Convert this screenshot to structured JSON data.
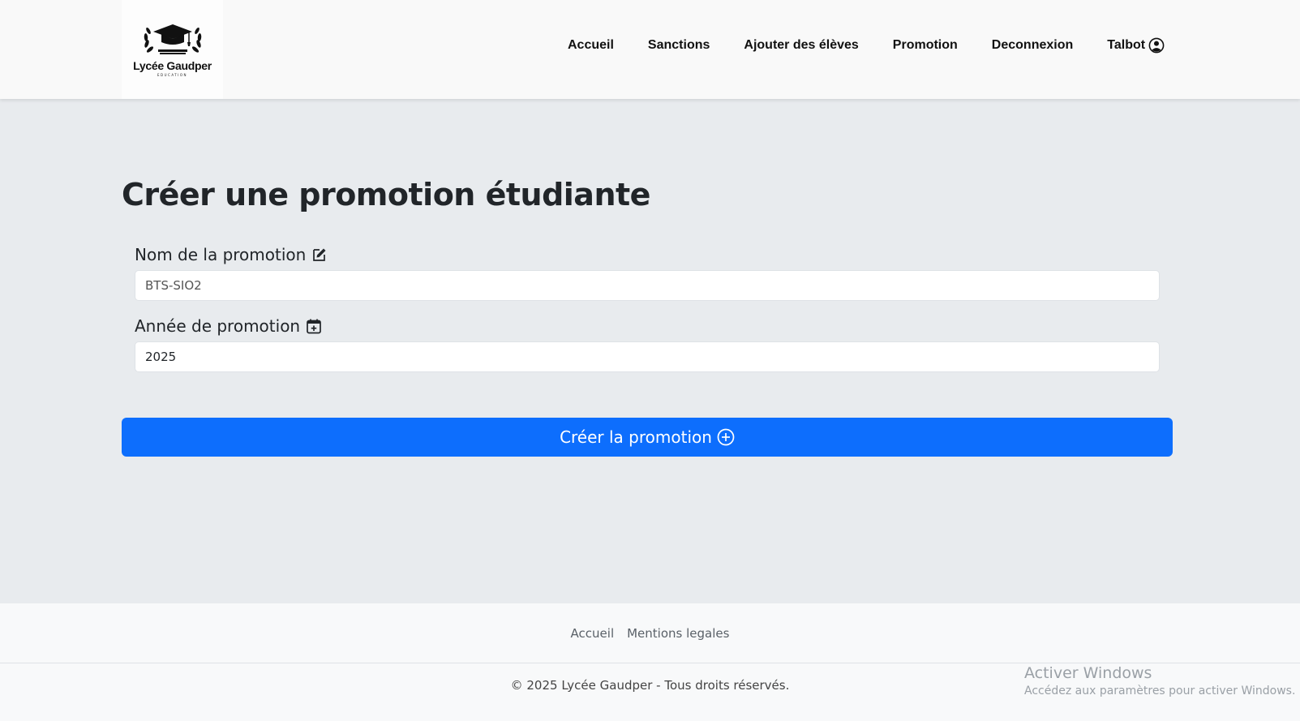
{
  "header": {
    "logo": {
      "title": "Lycée Gaudper",
      "subtitle": "EDUCATION",
      "icon": "graduation-cap-laurel-logo"
    },
    "nav": [
      {
        "label": "Accueil"
      },
      {
        "label": "Sanctions"
      },
      {
        "label": "Ajouter des élèves"
      },
      {
        "label": "Promotion"
      },
      {
        "label": "Deconnexion"
      }
    ],
    "user": {
      "name": "Talbot",
      "icon": "user-circle-icon"
    }
  },
  "main": {
    "title": "Créer une promotion étudiante",
    "fields": {
      "name": {
        "label": "Nom de la promotion",
        "icon": "edit-icon",
        "placeholder": "BTS-SIO2",
        "value": ""
      },
      "year": {
        "label": "Année de promotion",
        "icon": "calendar-plus-icon",
        "value": "2025"
      }
    },
    "submit_label": "Créer la promotion",
    "submit_icon": "plus-circle-icon"
  },
  "footer": {
    "links": [
      {
        "label": "Accueil"
      },
      {
        "label": "Mentions legales"
      }
    ],
    "copyright": "© 2025 Lycée Gaudper - Tous droits réservés."
  },
  "watermark": {
    "title": "Activer Windows",
    "subtitle": "Accédez aux paramètres pour activer Windows."
  },
  "colors": {
    "primary": "#0d6efd",
    "background": "#e8ebee",
    "navbar": "#f9f9f9",
    "footer": "#f8f9fa"
  }
}
